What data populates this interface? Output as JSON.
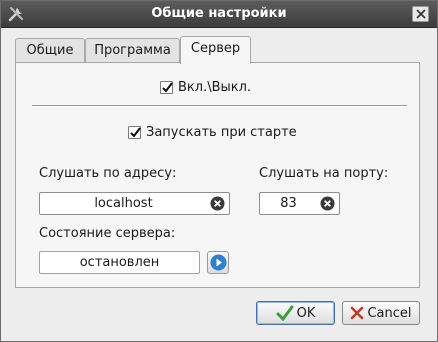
{
  "window": {
    "title": "Общие настройки"
  },
  "tabs": [
    {
      "label": "Общие",
      "active": false
    },
    {
      "label": "Программа",
      "active": false
    },
    {
      "label": "Сервер",
      "active": true
    }
  ],
  "server": {
    "enable_label": "Вкл.\\Выкл.",
    "enable_checked": true,
    "autostart_label": "Запускать при старте",
    "autostart_checked": true,
    "address_label": "Слушать по адресу:",
    "address_value": "localhost",
    "port_label": "Слушать на порту:",
    "port_value": "83",
    "status_label": "Состояние сервера:",
    "status_value": "остановлен"
  },
  "buttons": {
    "ok": "OK",
    "cancel": "Cancel"
  },
  "colors": {
    "play_accent": "#2f7fd4",
    "ok_icon": "#3f9a3a",
    "cancel_icon": "#c23b2b"
  },
  "icons": [
    "app-tools-icon",
    "window-close-icon",
    "clear-icon",
    "play-icon",
    "ok-check-icon",
    "cancel-x-icon"
  ]
}
